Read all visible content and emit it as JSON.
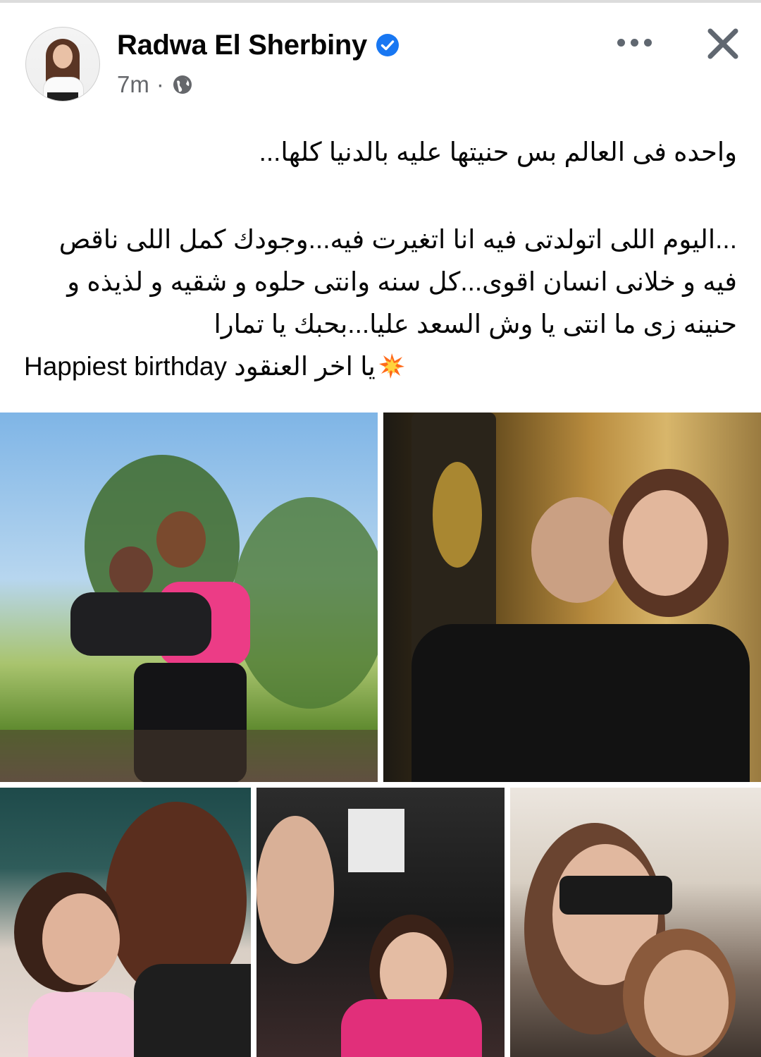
{
  "post": {
    "author": "Radwa El Sherbiny",
    "verified": true,
    "time": "7m",
    "separator": "·",
    "privacy_icon": "globe-icon"
  },
  "actions": {
    "more_icon": "more-horizontal-icon",
    "close_icon": "close-icon"
  },
  "text": {
    "line1": "واحده فى العالم بس حنيتها عليه بالدنيا كلها...",
    "line2": "...اليوم اللى اتولدتى فيه انا اتغيرت فيه...وجودك كمل اللى ناقص",
    "line3": "فيه و خلانى انسان اقوى...كل سنه وانتى حلوه و شقيه و لذيذه و",
    "line4": "حنينه زى ما انتى يا وش السعد عليا...بحبك يا تمارا",
    "line5_en": "Happiest birthday",
    "line5_ar": "يا اخر العنقود",
    "emoji": "collision-icon"
  },
  "colors": {
    "verified_blue": "#1877f2",
    "meta_gray": "#65676b",
    "text": "#050505"
  }
}
